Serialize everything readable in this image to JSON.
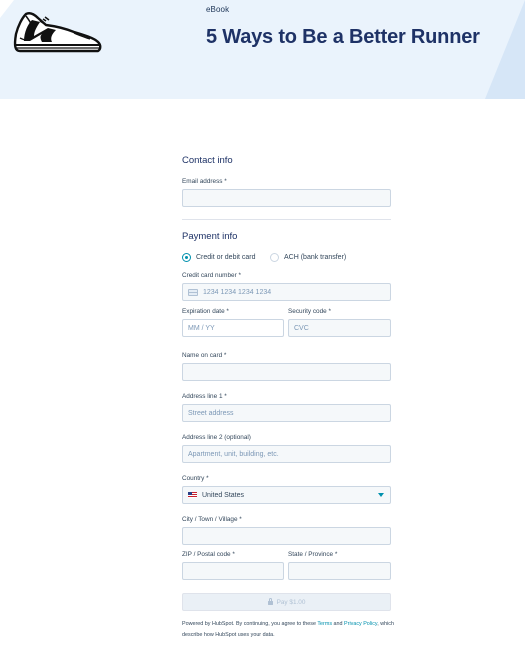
{
  "hero": {
    "kicker": "eBook",
    "title": "5 Ways to Be a Better Runner",
    "background_color": "#eaf3fc",
    "title_color": "#1e3266",
    "illustration_icon": "running-shoe-icon"
  },
  "contact": {
    "title": "Contact info",
    "email_label": "Email address *",
    "email_value": ""
  },
  "payment": {
    "title": "Payment info",
    "methods": [
      {
        "label": "Credit or debit card",
        "selected": true
      },
      {
        "label": "ACH (bank transfer)",
        "selected": false
      }
    ],
    "card_number_label": "Credit card number *",
    "card_number_placeholder": "1234 1234 1234 1234",
    "card_icon": "credit-card-icon",
    "expiration_label": "Expiration date *",
    "expiration_placeholder": "MM / YY",
    "security_label": "Security code *",
    "security_placeholder": "CVC",
    "name_label": "Name on card *",
    "name_value": "",
    "address1_label": "Address line 1 *",
    "address1_placeholder": "Street address",
    "address2_label": "Address line 2 (optional)",
    "address2_placeholder": "Apartment, unit, building, etc.",
    "country_label": "Country *",
    "country_value": "United States",
    "country_flag_icon": "us-flag-icon",
    "city_label": "City / Town / Village *",
    "city_value": "",
    "zip_label": "ZIP / Postal code *",
    "zip_value": "",
    "state_label": "State / Province *",
    "state_value": "",
    "pay_button_label": "Pay $1.00",
    "accent_color": "#0091ae"
  },
  "legal": {
    "text_before": "Powered by HubSpot. By continuing, you agree to these ",
    "terms_link": "Terms",
    "and_text": " and ",
    "privacy_link": "Privacy Policy",
    "text_after": ", which describe how HubSpot uses your data."
  }
}
